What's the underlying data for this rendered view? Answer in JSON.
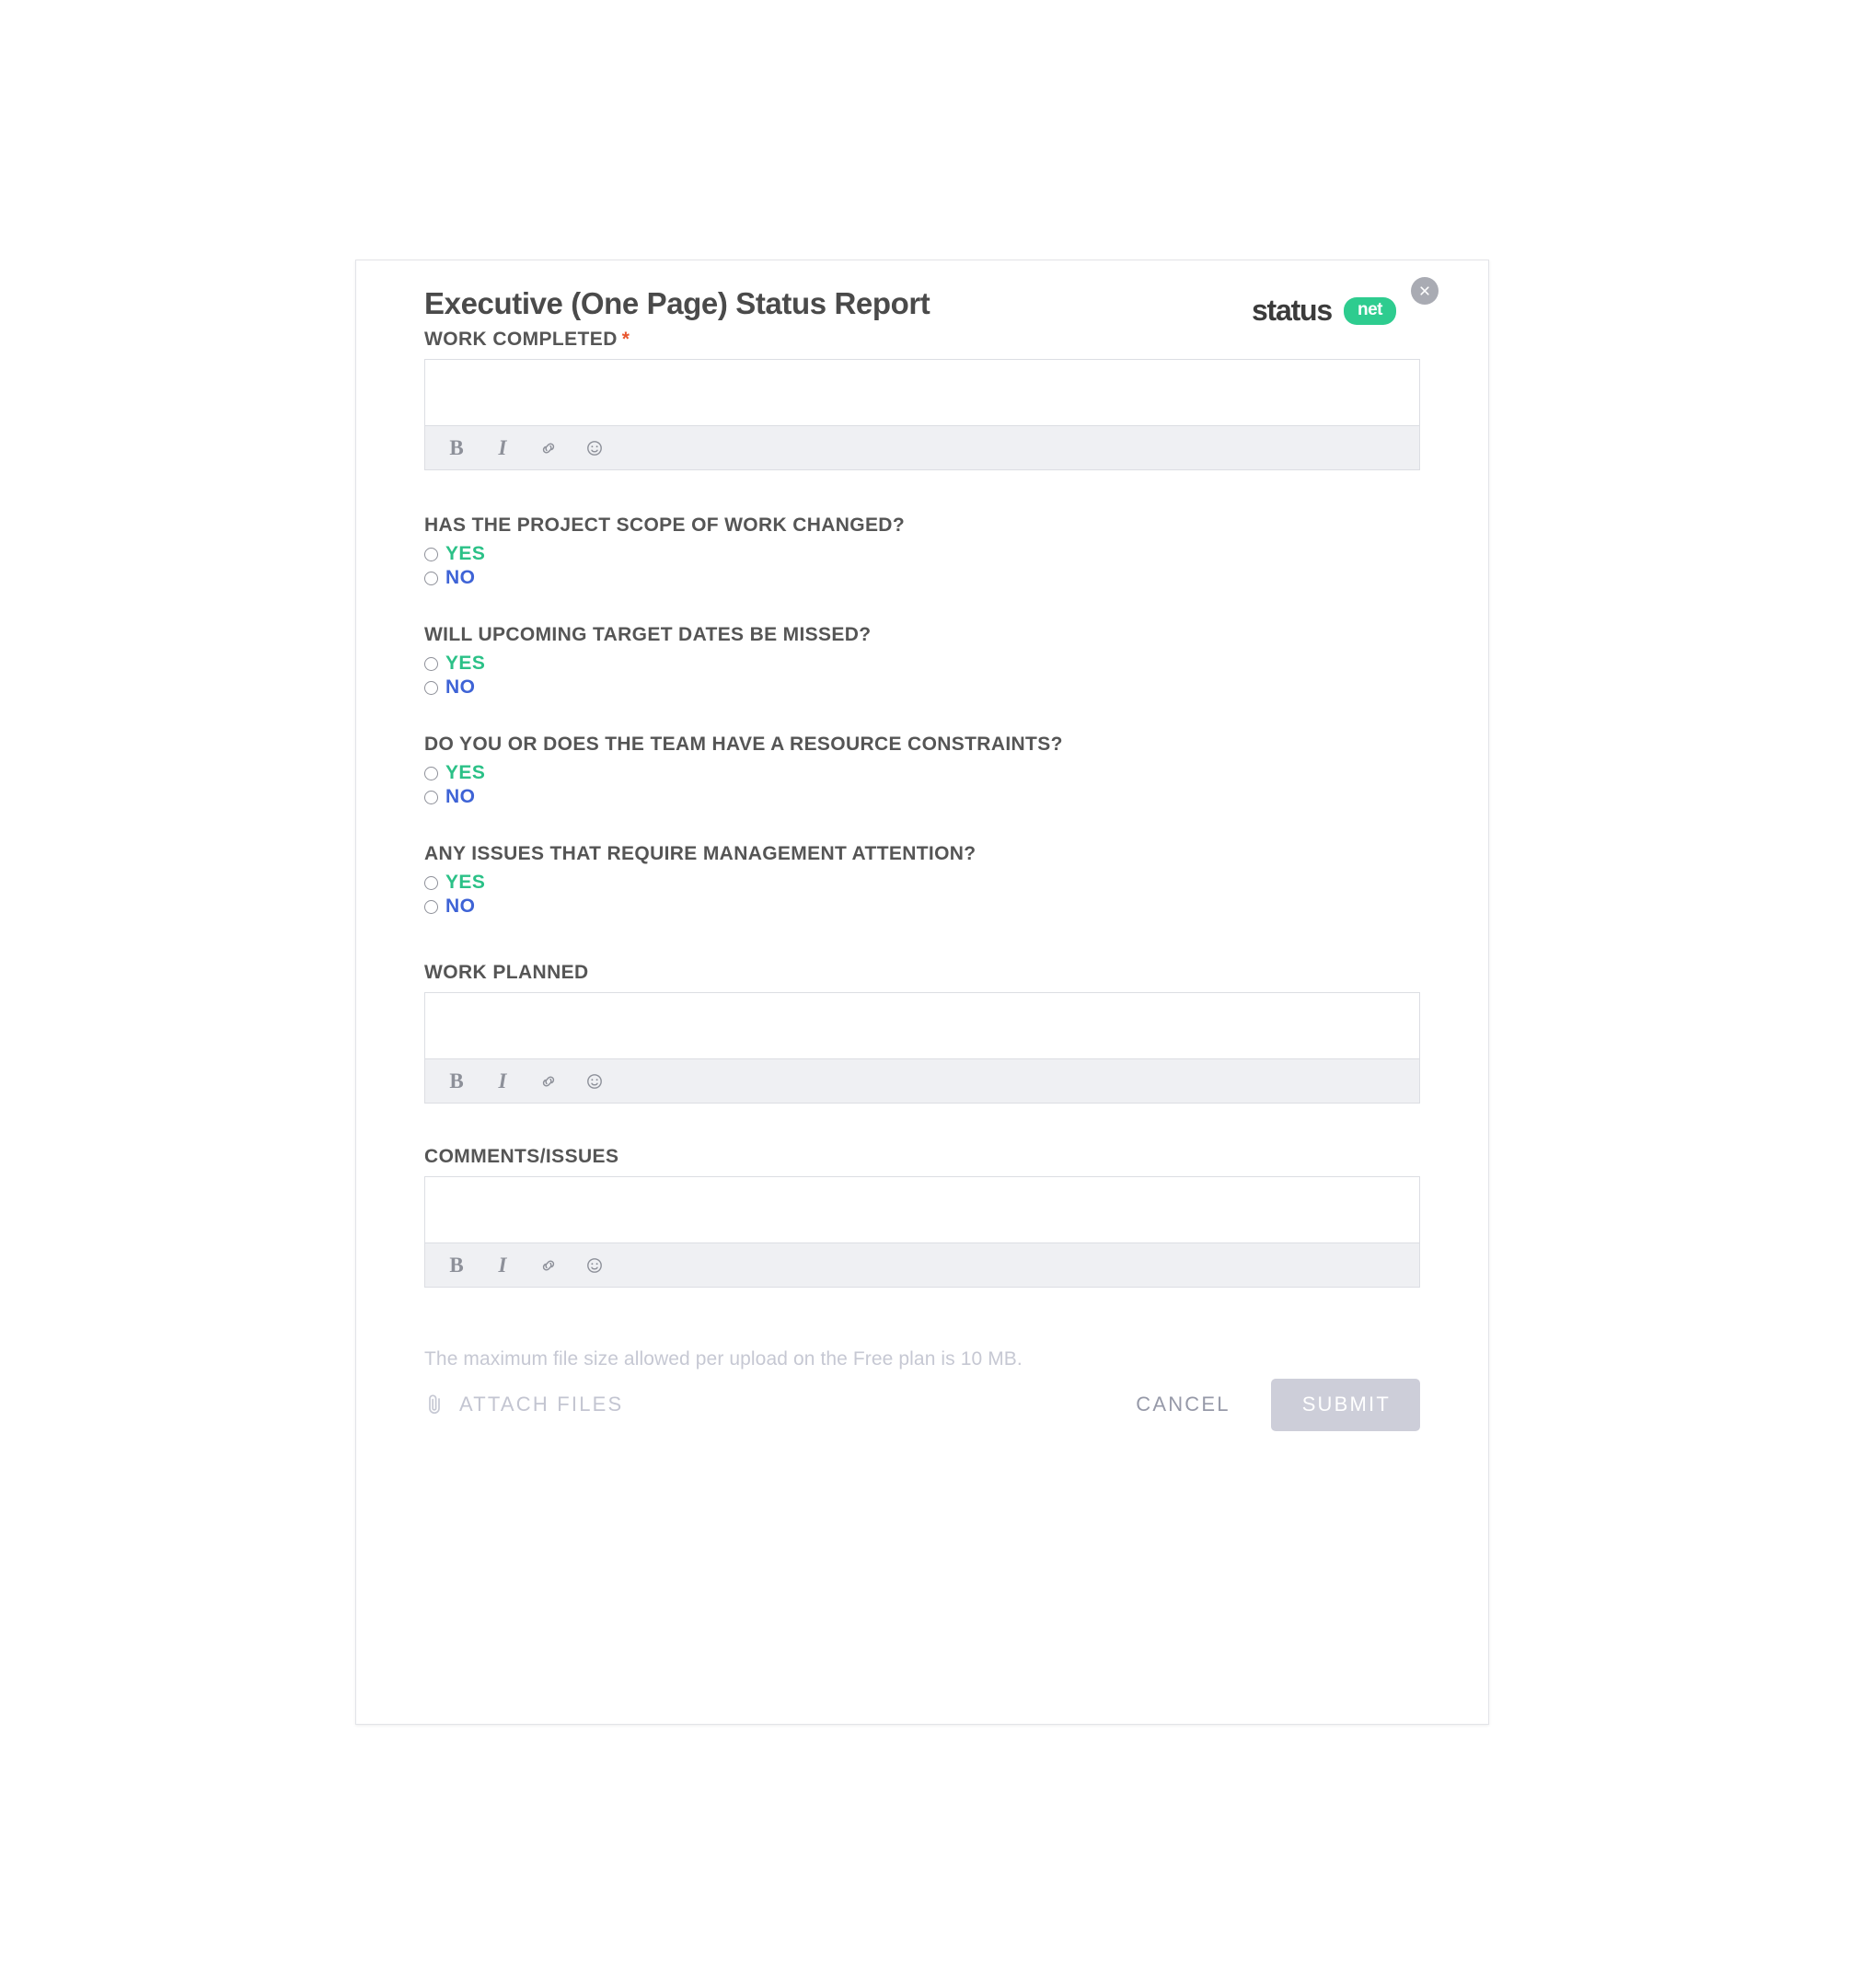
{
  "modal": {
    "title": "Executive (One Page) Status Report",
    "brand": {
      "word": "status",
      "pill": "net"
    },
    "close_icon": "close-icon"
  },
  "fields": {
    "work_completed": {
      "label": "WORK COMPLETED",
      "required_marker": "*",
      "value": "",
      "placeholder": ""
    },
    "work_planned": {
      "label": "WORK PLANNED",
      "value": "",
      "placeholder": ""
    },
    "comments_issues": {
      "label": "COMMENTS/ISSUES",
      "value": "",
      "placeholder": ""
    }
  },
  "editor_toolbar": {
    "bold": "B",
    "italic": "I",
    "link_icon": "link-icon",
    "emoji_icon": "emoji-icon"
  },
  "questions": [
    {
      "text": "HAS THE PROJECT SCOPE OF WORK CHANGED?",
      "options": [
        {
          "label": "YES",
          "selected": false
        },
        {
          "label": "NO",
          "selected": false
        }
      ]
    },
    {
      "text": "WILL UPCOMING TARGET DATES BE MISSED?",
      "options": [
        {
          "label": "YES",
          "selected": false
        },
        {
          "label": "NO",
          "selected": false
        }
      ]
    },
    {
      "text": "DO YOU OR DOES THE TEAM HAVE A RESOURCE CONSTRAINTS?",
      "options": [
        {
          "label": "YES",
          "selected": false
        },
        {
          "label": "NO",
          "selected": false
        }
      ]
    },
    {
      "text": "ANY ISSUES THAT REQUIRE MANAGEMENT ATTENTION?",
      "options": [
        {
          "label": "YES",
          "selected": false
        },
        {
          "label": "NO",
          "selected": false
        }
      ]
    }
  ],
  "footer": {
    "file_note": "The maximum file size allowed per upload on the Free plan is 10 MB.",
    "attach_label": "ATTACH FILES",
    "attach_icon": "paperclip-icon",
    "cancel_label": "CANCEL",
    "submit_label": "SUBMIT"
  },
  "colors": {
    "accent_green": "#2ecc8f",
    "yes_green": "#2bc187",
    "no_blue": "#3e63d6",
    "required_orange": "#e8552d",
    "submit_disabled": "#cdced9",
    "heading_gray": "#555555",
    "toolbar_bg": "#eff0f3"
  }
}
